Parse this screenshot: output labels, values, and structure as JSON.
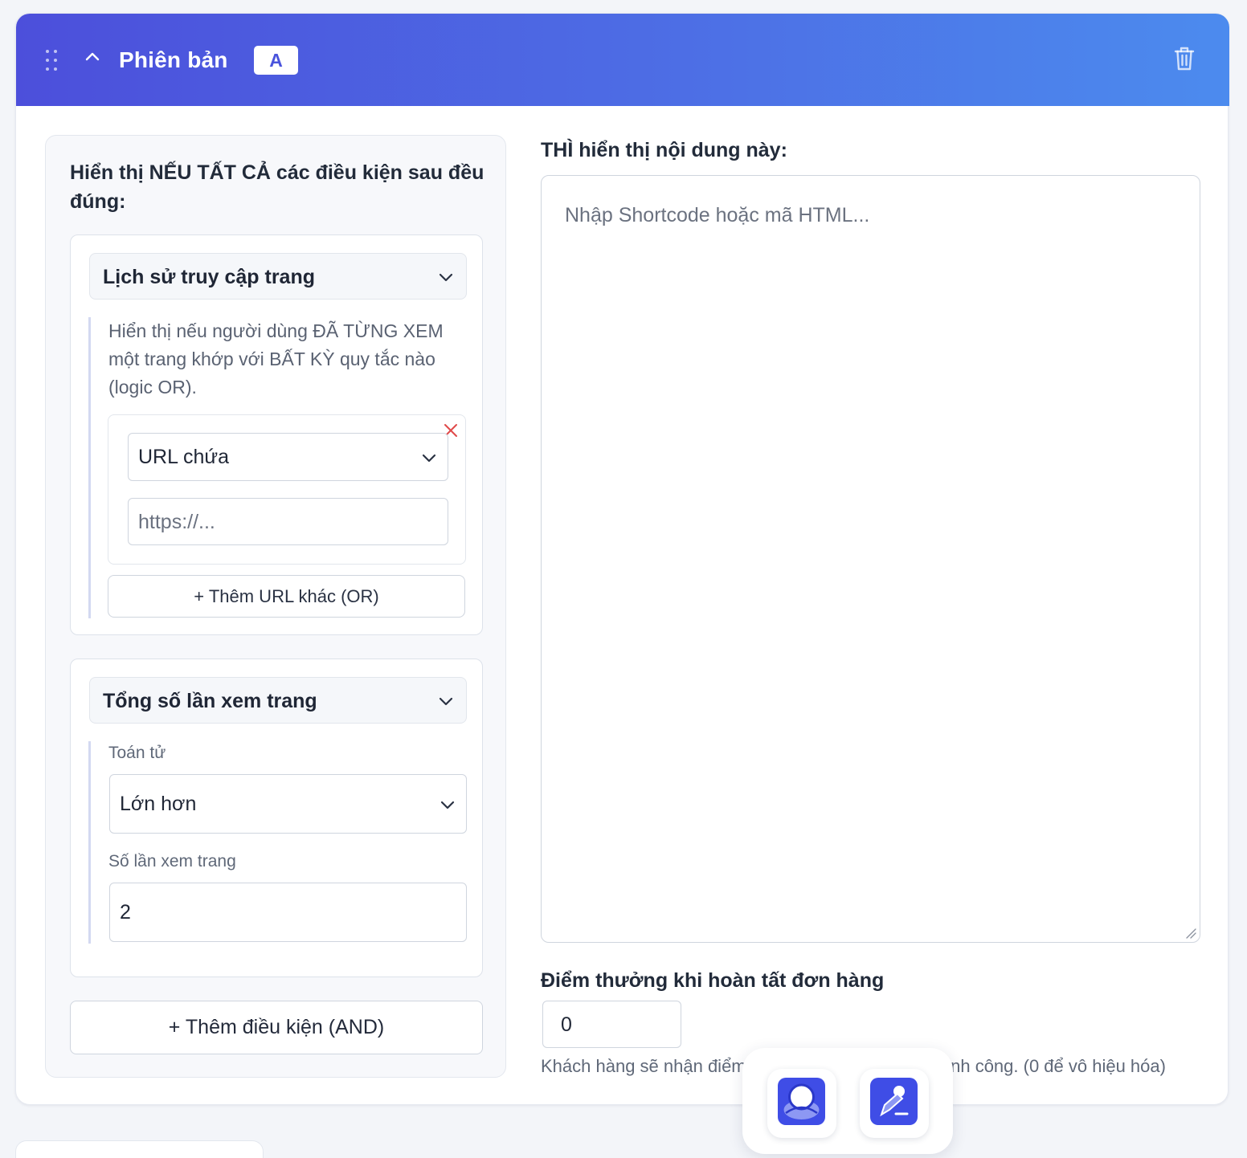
{
  "header": {
    "title": "Phiên bản",
    "variant_badge": "A"
  },
  "conditions_panel": {
    "heading": "Hiển thị NẾU TẤT CẢ các điều kiện sau đều đúng:",
    "conditions": [
      {
        "type_label": "Lịch sử truy cập trang",
        "description": "Hiển thị nếu người dùng ĐÃ TỪNG XEM một trang khớp với BẤT KỲ quy tắc nào (logic OR).",
        "url_rule": {
          "match_type": "URL chứa",
          "url_placeholder": "https://..."
        },
        "add_url_label": "+ Thêm URL khác (OR)"
      },
      {
        "type_label": "Tổng số lần xem trang",
        "operator_label": "Toán tử",
        "operator_value": "Lớn hơn",
        "count_label": "Số lần xem trang",
        "count_value": "2"
      }
    ],
    "add_condition_label": "+ Thêm điều kiện (AND)"
  },
  "content": {
    "heading": "THÌ hiển thị nội dung này:",
    "placeholder": "Nhập Shortcode hoặc mã HTML..."
  },
  "reward_points": {
    "heading": "Điểm thưởng khi hoàn tất đơn hàng",
    "value": "0",
    "help_left": "Khách hàng sẽ nhận điểm",
    "help_right": "hành công. (0 để vô hiệu hóa)"
  },
  "floating_toolbar": {
    "buttons": [
      "profile-app-icon",
      "edit-design-icon"
    ],
    "accent_color": "#3f4de6"
  },
  "colors": {
    "header_gradient_start": "#4c4fdb",
    "header_gradient_end": "#4c8bee",
    "remove_red": "#e04a4a"
  }
}
